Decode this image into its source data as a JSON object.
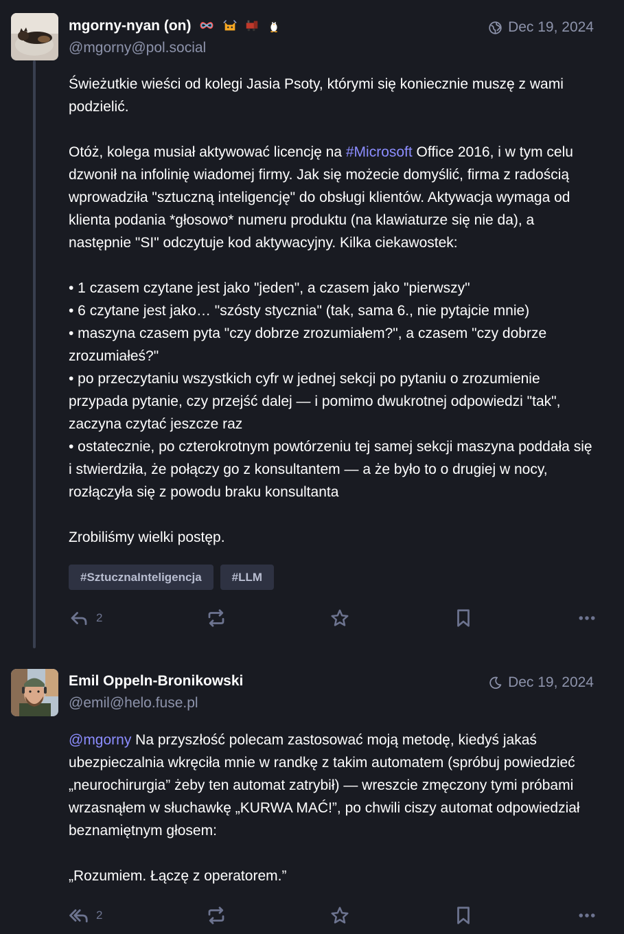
{
  "posts": [
    {
      "display_name": "mgorny-nyan (on)",
      "name_emojis": [
        "infinity-rainbow-emoji",
        "cat-emoji",
        "train-emoji",
        "penguin-emoji"
      ],
      "handle": "@mgorny@pol.social",
      "visibility_icon": "globe-icon",
      "date": "Dec 19, 2024",
      "paragraphs": [
        "Świeżutkie wieści od kolegi Jasia Psoty, którymi się koniecznie muszę z wami podzielić.",
        "",
        "• 1 czasem czytane jest jako \"jeden\", a czasem jako \"pierwszy\"",
        "• 6 czytane jest jako… \"szósty stycznia\" (tak, sama 6., nie pytajcie mnie)",
        "• maszyna czasem pyta \"czy dobrze zrozumiałem?\", a czasem \"czy dobrze zrozumiałeś?\"",
        "• po przeczytaniu wszystkich cyfr w jednej sekcji po pytaniu o zrozumienie przypada pytanie, czy przejść dalej — i pomimo dwukrotnej odpowiedzi \"tak\", zaczyna czytać jeszcze raz",
        "• ostatecznie, po czterokrotnym powtórzeniu tej samej sekcji maszyna poddała się i stwierdziła, że połączy go z konsultantem — a że było to o drugiej w nocy, rozłączyła się z powodu braku konsultanta",
        "Zrobiliśmy wielki postęp."
      ],
      "p2_before": "Otóż, kolega musiał aktywować licencję na ",
      "p2_hashtag": "#Microsoft",
      "p2_after": " Office 2016, i w tym celu dzwonił na infolinię wiadomej firmy. Jak się możecie domyślić, firma z radością wprowadziła \"sztuczną inteligencję\" do obsługi klientów. Aktywacja wymaga od klienta podania *głosowo* numeru produktu (na klawiaturze się nie da), a następnie \"SI\" odczytuje kod aktywacyjny. Kilka ciekawostek:",
      "tags": [
        "#SztucznaInteligencja",
        "#LLM"
      ],
      "reply_count": "2"
    },
    {
      "display_name": "Emil Oppeln-Bronikowski",
      "handle": "@emil@helo.fuse.pl",
      "visibility_icon": "moon-icon",
      "date": "Dec 19, 2024",
      "mention": "@mgorny",
      "p1_after": " Na przyszłość polecam zastosować moją metodę, kiedyś jakaś ubezpieczalnia wkręciła mnie w randkę z takim automatem (spróbuj powiedzieć „neurochirurgia” żeby ten automat zatrybił) — wreszcie zmęczony tymi próbami wrzasnąłem w słuchawkę „KURWA MAĆ!”, po chwili ciszy automat odpowiedział beznamiętnym głosem:",
      "p2": "„Rozumiem. Łączę z operatorem.”",
      "reply_count": "2"
    }
  ]
}
